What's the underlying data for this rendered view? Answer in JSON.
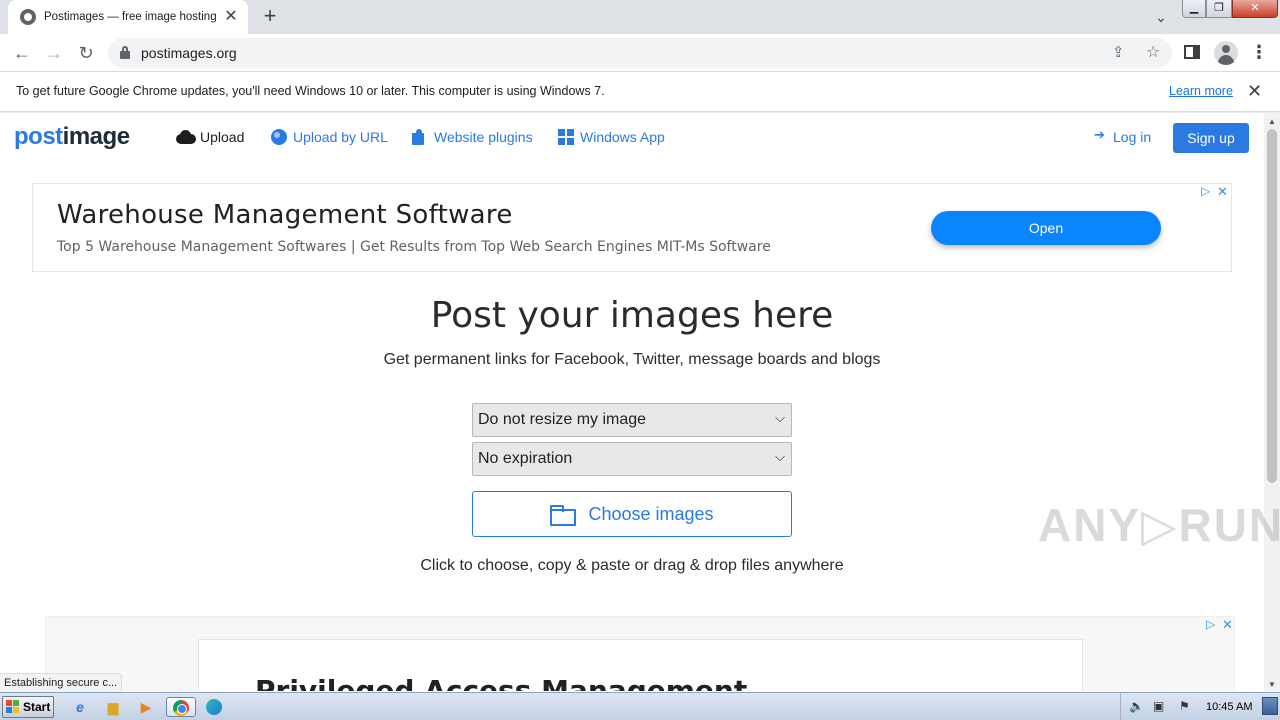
{
  "browser": {
    "tab_title": "Postimages — free image hosting / image upload",
    "new_tab": "+",
    "tab_close": "✕",
    "url": "postimages.org"
  },
  "infobar": {
    "message": "To get future Google Chrome updates, you'll need Windows 10 or later. This computer is using Windows 7.",
    "learn_more": "Learn more",
    "close": "✕"
  },
  "site_nav": {
    "logo_a": "post",
    "logo_b": "image",
    "upload": "Upload",
    "upload_by_url": "Upload by URL",
    "website_plugins": "Website plugins",
    "windows_app": "Windows App",
    "log_in": "Log in",
    "sign_up": "Sign up"
  },
  "ad_top": {
    "title": "Warehouse Management Software",
    "subtitle": "Top 5 Warehouse Management Softwares | Get Results from Top Web Search Engines MIT-Ms Software",
    "cta": "Open"
  },
  "hero": {
    "title": "Post your images here",
    "subtitle": "Get permanent links for Facebook, Twitter, message boards and blogs"
  },
  "form": {
    "resize_selected": "Do not resize my image",
    "expiration_selected": "No expiration",
    "choose_images": "Choose images",
    "hint": "Click to choose, copy & paste or drag & drop files anywhere"
  },
  "ad_bottom": {
    "title": "Privileged Access Management"
  },
  "status": "Establishing secure c...",
  "watermark": "ANY▷RUN",
  "taskbar": {
    "start": "Start",
    "clock": "10:45 AM"
  },
  "colors": {
    "brand_blue": "#2a7ae2",
    "ad_button": "#0a84ff"
  }
}
